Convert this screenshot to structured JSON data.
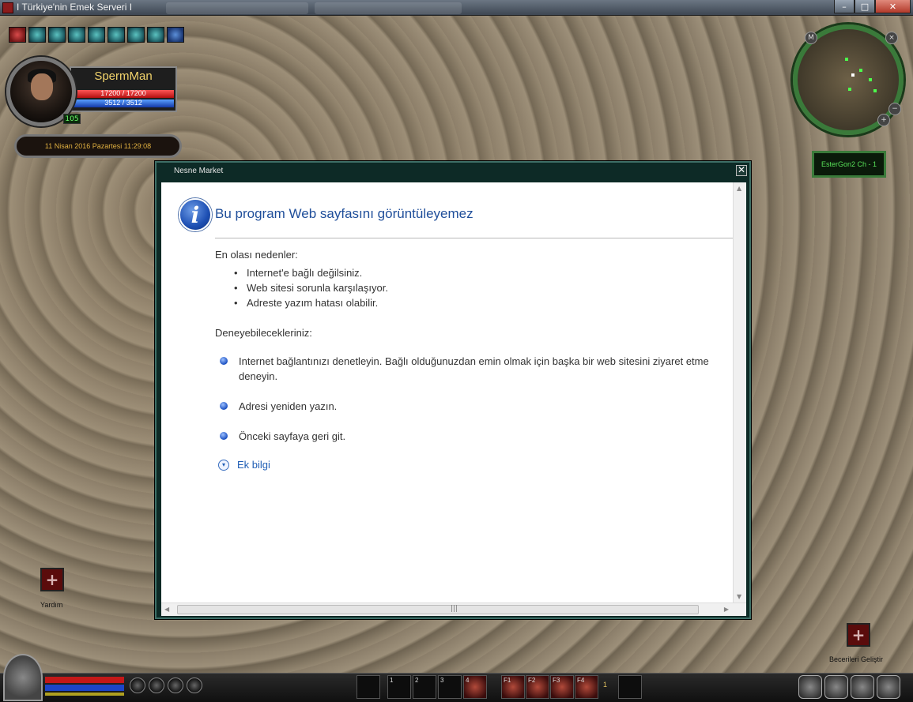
{
  "window": {
    "title": "I Türkiye'nin Emek Serveri I",
    "minimize": "–",
    "maximize": "□",
    "close": "✕"
  },
  "player": {
    "name": "SpermMan",
    "hp_text": "17200 / 17200",
    "mp_text": "3512 / 3512",
    "level": "105",
    "date_time": "11 Nisan 2016 Pazartesi 11:29:08"
  },
  "minimap": {
    "map_button": "M",
    "close_button": "×",
    "zoom_out": "−",
    "zoom_in": "+",
    "channel": "EsterGon2 Ch - 1"
  },
  "helpers": {
    "help_label": "Yardım",
    "skills_label": "Becerileri Geliştir",
    "plus_symbol": "+"
  },
  "hotbar": {
    "slot_1": "1",
    "slot_2": "2",
    "slot_3": "3",
    "slot_4": "4",
    "slot_f1": "F1",
    "slot_f2": "F2",
    "slot_f3": "F3",
    "slot_f4": "F4",
    "page": "1"
  },
  "market": {
    "title": "Nesne Market",
    "close": "✕",
    "error": {
      "icon_glyph": "i",
      "title": "Bu program Web sayfasını görüntüleyemez",
      "reasons_heading": "En olası nedenler:",
      "reasons": [
        "Internet'e bağlı değilsiniz.",
        "Web sitesi sorunla karşılaşıyor.",
        "Adreste yazım hatası olabilir."
      ],
      "tips_heading": "Deneyebilecekleriniz:",
      "tips": [
        "Internet bağlantınızı denetleyin. Bağlı olduğunuzdan emin olmak için başka bir web sitesini ziyaret etme deneyin.",
        "Adresi yeniden yazın.",
        "Önceki sayfaya geri git."
      ],
      "more_info": "Ek bilgi",
      "more_glyph": "▾"
    },
    "scroll": {
      "up": "▲",
      "down": "▼",
      "left": "◀",
      "right": "▶",
      "grip": "|||"
    }
  },
  "colors": {
    "accent_link": "#1f5eb5",
    "title_blue": "#1f4e9a",
    "modal_frame": "#0d2a26",
    "player_name": "#f1d36b"
  }
}
